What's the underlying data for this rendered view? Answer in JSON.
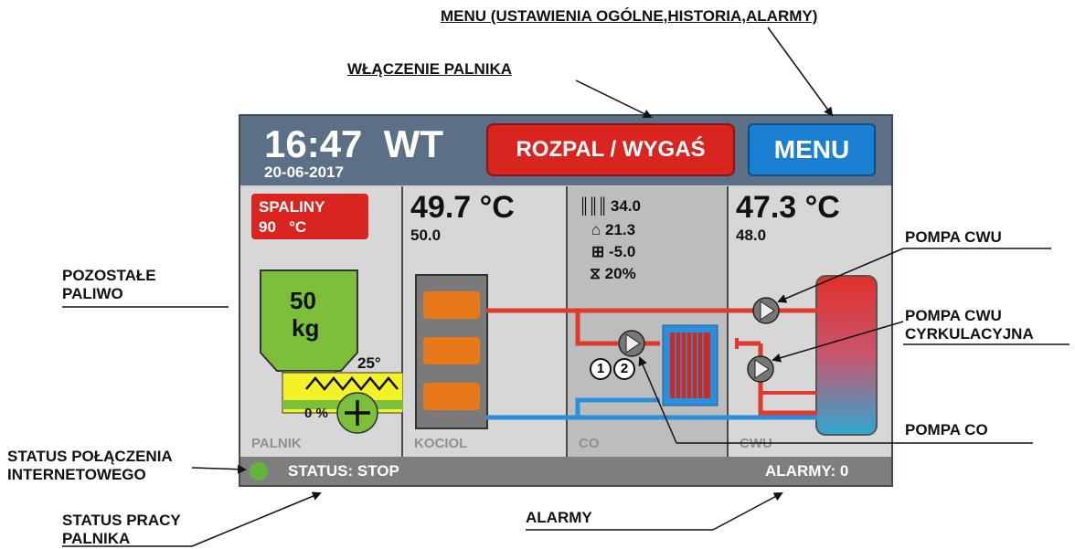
{
  "callouts": {
    "menu": "MENU (USTAWIENIA OGÓLNE,HISTORIA,ALARMY)",
    "burner_on": "WŁĄCZENIE PALNIKA",
    "fuel_line1": "POZOSTAŁE",
    "fuel_line2": "PALIWO",
    "pump_cwu": "POMPA CWU",
    "pump_circ_line1": "POMPA CWU",
    "pump_circ_line2": "CYRKULACYJNA",
    "pump_co": "POMPA CO",
    "net_line1": "STATUS POŁĄCZENIA",
    "net_line2": "INTERNETOWEGO",
    "work_line1": "STATUS PRACY",
    "work_line2": "PALNIKA",
    "alarms": "ALARMY"
  },
  "header": {
    "time": "16:47",
    "day": "WT",
    "date": "20-06-2017",
    "ignite_button": "ROZPAL / WYGAŚ",
    "menu_button": "MENU"
  },
  "palnik": {
    "flue_label": "SPALINY",
    "flue_value": "90",
    "flue_unit": "°C",
    "fuel_value": "50",
    "fuel_unit": "kg",
    "angle": "25°",
    "power": "0 %",
    "label": "PALNIK"
  },
  "kociol": {
    "temp": "49.7 °C",
    "setpoint": "50.0",
    "label": "KOCIOL"
  },
  "co": {
    "radiator_temp": "34.0",
    "room_temp": "21.3",
    "outdoor_temp": "-5.0",
    "valve": "20%",
    "pump1": "1",
    "pump2": "2",
    "label": "CO"
  },
  "cwu": {
    "temp": "47.3 °C",
    "setpoint": "48.0",
    "label": "CWU"
  },
  "status": {
    "text": "STATUS: STOP",
    "alarms": "ALARMY: 0"
  },
  "colors": {
    "header": "#5b6f86",
    "red_button": "#d9241f",
    "blue_button": "#1a7fd0",
    "hot_pipe": "#e03a2e",
    "cold_pipe": "#2a8fd8",
    "fuel": "#7cbf3a",
    "status_ok": "#63b43a"
  }
}
